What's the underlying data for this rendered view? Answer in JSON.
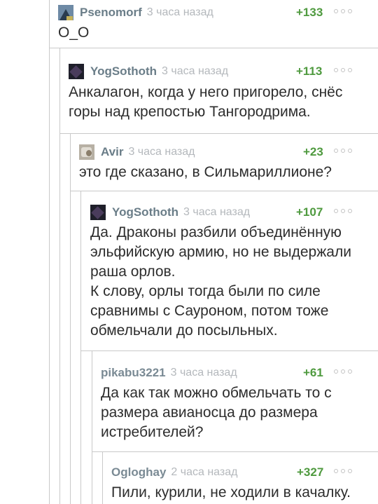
{
  "comments": [
    {
      "author": "Psenomorf",
      "time": "3 часа назад",
      "rating": "+133",
      "avatar": "mountain-avatar",
      "lines": [
        "О_О"
      ]
    },
    {
      "author": "YogSothoth",
      "time": "3 часа назад",
      "rating": "+113",
      "avatar": "dark-avatar",
      "lines": [
        "Анкалагон, когда у него пригорело, снёс",
        "горы над крепостью Тангородрима."
      ]
    },
    {
      "author": "Avir",
      "time": "3 часа назад",
      "rating": "+23",
      "avatar": "photo-avatar",
      "lines": [
        "это где сказано, в Сильмариллионе?"
      ]
    },
    {
      "author": "YogSothoth",
      "time": "3 часа назад",
      "rating": "+107",
      "avatar": "dark-avatar",
      "lines": [
        "Да. Драконы разбили объединённую",
        "эльфийскую армию, но не выдержали",
        "раша орлов.",
        "К слову, орлы тогда были по силе",
        "сравнимы с Сауроном, потом тоже",
        "обмельчали до посыльных."
      ]
    },
    {
      "author": "pikabu3221",
      "time": "3 часа назад",
      "rating": "+61",
      "avatar": "",
      "lines": [
        "Да как так можно обмельчать то с",
        "размера авианосца до размера",
        "истребителей?"
      ]
    },
    {
      "author": "Ogloghay",
      "time": "2 часа назад",
      "rating": "+327",
      "avatar": "",
      "lines": [
        "Пили, курили, не ходили в качалку."
      ]
    }
  ]
}
